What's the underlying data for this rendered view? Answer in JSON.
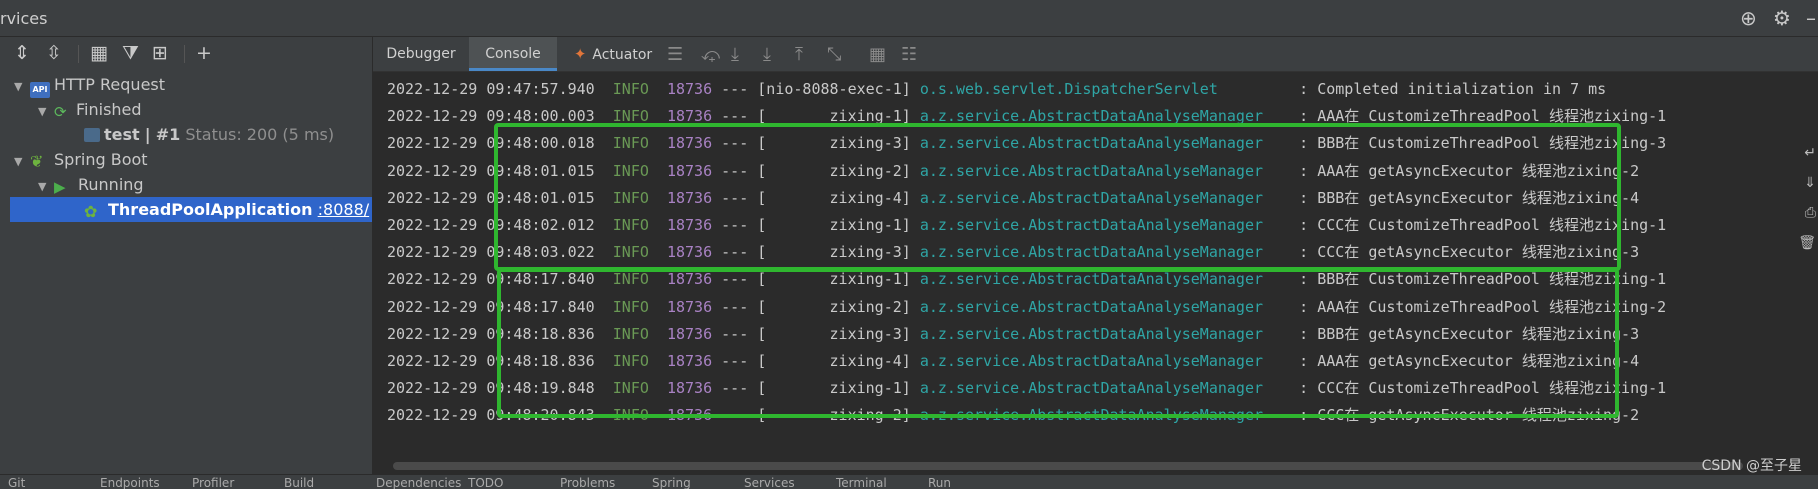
{
  "window": {
    "title": "rvices"
  },
  "tabs": [
    {
      "label": "Debugger"
    },
    {
      "label": "Console"
    },
    {
      "label": "Actuator"
    }
  ],
  "tree": {
    "http_request": "HTTP Request",
    "finished": "Finished",
    "test_name": "test",
    "test_sep": "|",
    "test_id": "#1",
    "test_status": "Status: 200 (5 ms)",
    "spring_boot": "Spring Boot",
    "running": "Running",
    "app_name": "ThreadPoolApplication",
    "app_port": ":8088/"
  },
  "console": {
    "lines": [
      {
        "date": "2022-12-29",
        "time": "09:47:57.940",
        "level": "INFO",
        "pid": "18736",
        "sep": "---",
        "thread": "[nio-8088-exec-1]",
        "logger": "o.s.web.servlet.DispatcherServlet       ",
        "msg": ": Completed initialization in 7 ms"
      },
      {
        "date": "2022-12-29",
        "time": "09:48:00.003",
        "level": "INFO",
        "pid": "18736",
        "sep": "---",
        "thread": "[       zixing-1]",
        "logger": "a.z.service.AbstractDataAnalyseManager  ",
        "msg": ": AAA在 CustomizeThreadPool 线程池zixing-1"
      },
      {
        "date": "2022-12-29",
        "time": "09:48:00.018",
        "level": "INFO",
        "pid": "18736",
        "sep": "---",
        "thread": "[       zixing-3]",
        "logger": "a.z.service.AbstractDataAnalyseManager  ",
        "msg": ": BBB在 CustomizeThreadPool 线程池zixing-3"
      },
      {
        "date": "2022-12-29",
        "time": "09:48:01.015",
        "level": "INFO",
        "pid": "18736",
        "sep": "---",
        "thread": "[       zixing-2]",
        "logger": "a.z.service.AbstractDataAnalyseManager  ",
        "msg": ": AAA在 getAsyncExecutor 线程池zixing-2"
      },
      {
        "date": "2022-12-29",
        "time": "09:48:01.015",
        "level": "INFO",
        "pid": "18736",
        "sep": "---",
        "thread": "[       zixing-4]",
        "logger": "a.z.service.AbstractDataAnalyseManager  ",
        "msg": ": BBB在 getAsyncExecutor 线程池zixing-4"
      },
      {
        "date": "2022-12-29",
        "time": "09:48:02.012",
        "level": "INFO",
        "pid": "18736",
        "sep": "---",
        "thread": "[       zixing-1]",
        "logger": "a.z.service.AbstractDataAnalyseManager  ",
        "msg": ": CCC在 CustomizeThreadPool 线程池zixing-1"
      },
      {
        "date": "2022-12-29",
        "time": "09:48:03.022",
        "level": "INFO",
        "pid": "18736",
        "sep": "---",
        "thread": "[       zixing-3]",
        "logger": "a.z.service.AbstractDataAnalyseManager  ",
        "msg": ": CCC在 getAsyncExecutor 线程池zixing-3"
      },
      {
        "date": "2022-12-29",
        "time": "09:48:17.840",
        "level": "INFO",
        "pid": "18736",
        "sep": "---",
        "thread": "[       zixing-1]",
        "logger": "a.z.service.AbstractDataAnalyseManager  ",
        "msg": ": BBB在 CustomizeThreadPool 线程池zixing-1"
      },
      {
        "date": "2022-12-29",
        "time": "09:48:17.840",
        "level": "INFO",
        "pid": "18736",
        "sep": "---",
        "thread": "[       zixing-2]",
        "logger": "a.z.service.AbstractDataAnalyseManager  ",
        "msg": ": AAA在 CustomizeThreadPool 线程池zixing-2"
      },
      {
        "date": "2022-12-29",
        "time": "09:48:18.836",
        "level": "INFO",
        "pid": "18736",
        "sep": "---",
        "thread": "[       zixing-3]",
        "logger": "a.z.service.AbstractDataAnalyseManager  ",
        "msg": ": BBB在 getAsyncExecutor 线程池zixing-3"
      },
      {
        "date": "2022-12-29",
        "time": "09:48:18.836",
        "level": "INFO",
        "pid": "18736",
        "sep": "---",
        "thread": "[       zixing-4]",
        "logger": "a.z.service.AbstractDataAnalyseManager  ",
        "msg": ": AAA在 getAsyncExecutor 线程池zixing-4"
      },
      {
        "date": "2022-12-29",
        "time": "09:48:19.848",
        "level": "INFO",
        "pid": "18736",
        "sep": "---",
        "thread": "[       zixing-1]",
        "logger": "a.z.service.AbstractDataAnalyseManager  ",
        "msg": ": CCC在 CustomizeThreadPool 线程池zixing-1"
      },
      {
        "date": "2022-12-29",
        "time": "09:48:20.843",
        "level": "INFO",
        "pid": "18736",
        "sep": "---",
        "thread": "[       zixing-2]",
        "logger": "a.z.service.AbstractDataAnalyseManager  ",
        "msg": ": CCC在 getAsyncExecutor 线程池zixing-2"
      }
    ]
  },
  "bottom_bar": {
    "items": [
      "Git",
      "Endpoints",
      "Profiler",
      "Build",
      "Dependencies",
      "TODO",
      "Problems",
      "Spring",
      "Services",
      "Terminal",
      "Run"
    ]
  },
  "watermark": "CSDN @至子星",
  "colors": {
    "highlight": "#2fb62f",
    "accent": "#2f65ca"
  }
}
